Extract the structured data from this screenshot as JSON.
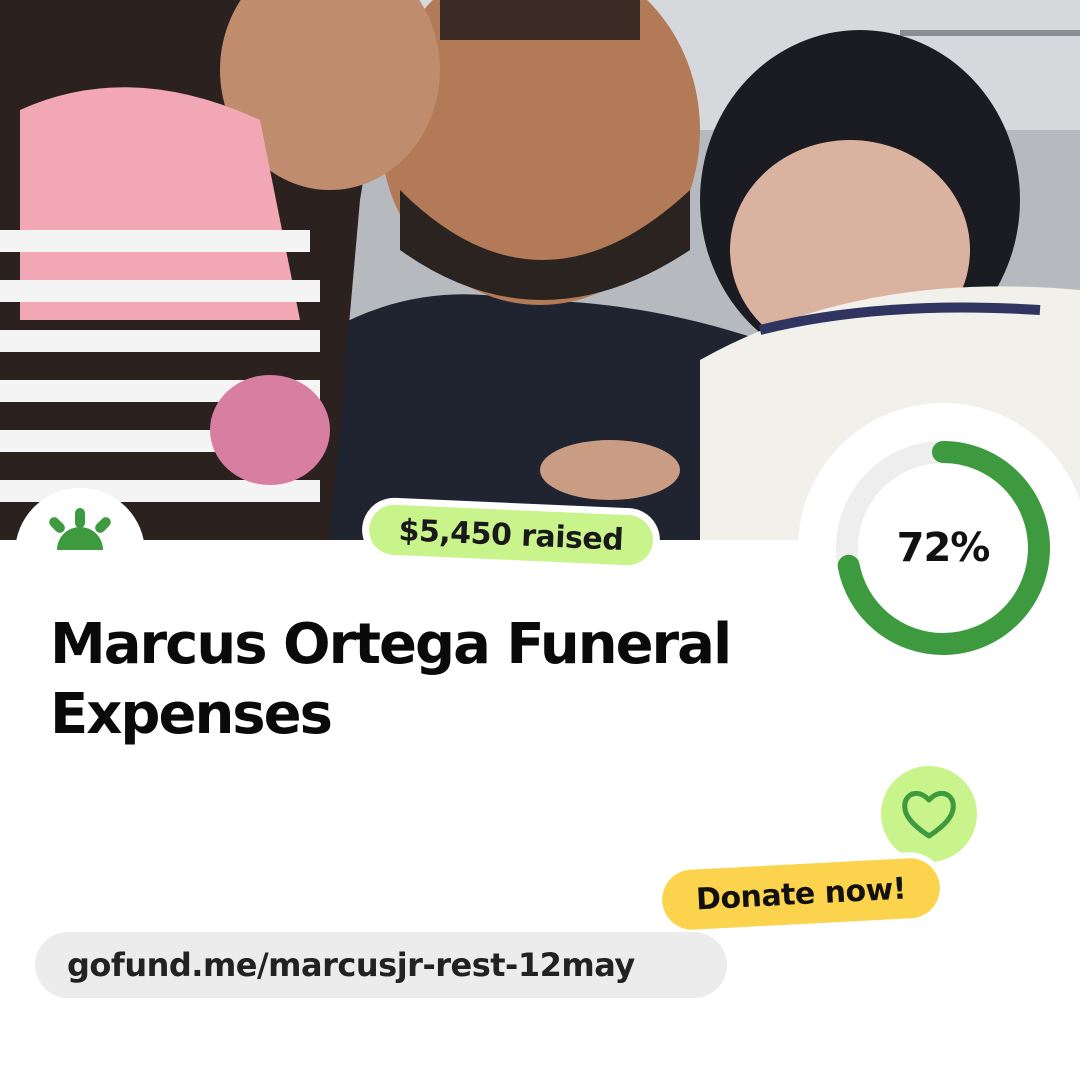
{
  "campaign": {
    "raised_label": "$5,450 raised",
    "progress": 0.72,
    "progress_label": "72%",
    "title": "Marcus Ortega Funeral Expenses",
    "cta_label": "Donate now!",
    "url": "gofund.me/marcusjr-rest-12may"
  },
  "icons": {
    "logo": "sunrise-icon",
    "heart": "heart-icon"
  },
  "colors": {
    "brand_green": "#3d9a3f",
    "accent_lime": "#c9f48c",
    "cta_yellow": "#fcd34d",
    "track_gray": "#eeeeee",
    "url_bg": "#ececec"
  }
}
